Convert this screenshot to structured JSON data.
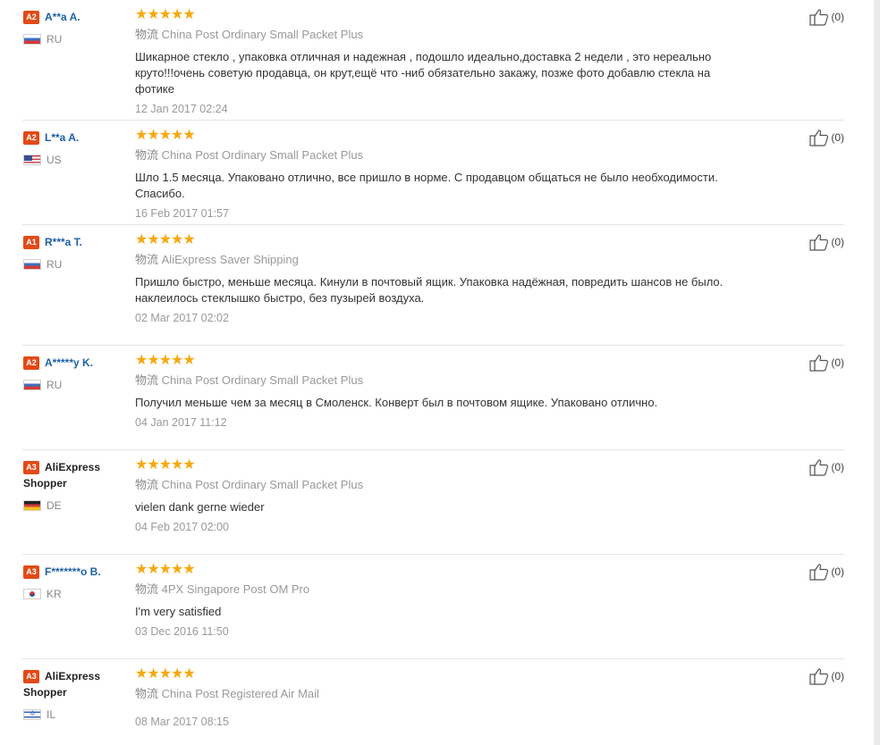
{
  "reviews": [
    {
      "level": "A2",
      "name": "A**a A.",
      "shopper": false,
      "country": "RU",
      "flag": "ru",
      "stars": "★★★★★",
      "rating": 5,
      "logistics_label": "物流",
      "logistics": "China Post Ordinary Small Packet Plus",
      "text": "Шикарное стекло , упаковка отличная и надежная , подошло идеально,доставка 2 недели , это нереально круто!!!очень советую продавца, он крут,ещё что -ниб обязательно закажу, позже фото добавлю стекла на фотике",
      "date": "12 Jan 2017 02:24",
      "helpful": "(0)"
    },
    {
      "level": "A2",
      "name": "L**a A.",
      "shopper": false,
      "country": "US",
      "flag": "us",
      "stars": "★★★★★",
      "rating": 5,
      "logistics_label": "物流",
      "logistics": "China Post Ordinary Small Packet Plus",
      "text": "Шло 1.5 месяца. Упаковано отлично, все пришло в норме. С продавцом общаться не было необходимости. Спасибо.",
      "date": "16 Feb 2017 01:57",
      "helpful": "(0)"
    },
    {
      "level": "A1",
      "name": "R***a T.",
      "shopper": false,
      "country": "RU",
      "flag": "ru",
      "stars": "★★★★★",
      "rating": 5,
      "logistics_label": "物流",
      "logistics": "AliExpress Saver Shipping",
      "text": "Пришло быстро, меньше месяца. Кинули в почтовый ящик. Упаковка надёжная, повредить шансов не было. наклеилось стеклышко быстро, без пузырей воздуха.",
      "date": "02 Mar 2017 02:02",
      "helpful": "(0)"
    },
    {
      "level": "A2",
      "name": "A*****y K.",
      "shopper": false,
      "country": "RU",
      "flag": "ru",
      "stars": "★★★★★",
      "rating": 5,
      "logistics_label": "物流",
      "logistics": "China Post Ordinary Small Packet Plus",
      "text": "Получил меньше чем за месяц в Смоленск. Конверт был в почтовом ящике. Упаковано отлично.",
      "date": "04 Jan 2017 11:12",
      "helpful": "(0)"
    },
    {
      "level": "A3",
      "name": "AliExpress Shopper",
      "shopper": true,
      "country": "DE",
      "flag": "de",
      "stars": "★★★★★",
      "rating": 5,
      "logistics_label": "物流",
      "logistics": "China Post Ordinary Small Packet Plus",
      "text": "vielen dank gerne wieder",
      "date": "04 Feb 2017 02:00",
      "helpful": "(0)"
    },
    {
      "level": "A3",
      "name": "F*******o B.",
      "shopper": false,
      "country": "KR",
      "flag": "kr",
      "stars": "★★★★★",
      "rating": 5,
      "logistics_label": "物流",
      "logistics": "4PX Singapore Post OM Pro",
      "text": "I'm very satisfied",
      "date": "03 Dec 2016 11:50",
      "helpful": "(0)"
    },
    {
      "level": "A3",
      "name": "AliExpress Shopper",
      "shopper": true,
      "country": "IL",
      "flag": "il",
      "stars": "★★★★★",
      "rating": 5,
      "logistics_label": "物流",
      "logistics": "China Post Registered Air Mail",
      "text": "",
      "date": "08 Mar 2017 08:15",
      "helpful": "(0)"
    }
  ],
  "colors": {
    "level_badge": "#e24a18",
    "username": "#1d5fa8",
    "stars": "#f7a80c",
    "muted_text": "#999999"
  },
  "icons": {
    "helpful": "thumbs-up-icon",
    "rating": "star-icon"
  }
}
